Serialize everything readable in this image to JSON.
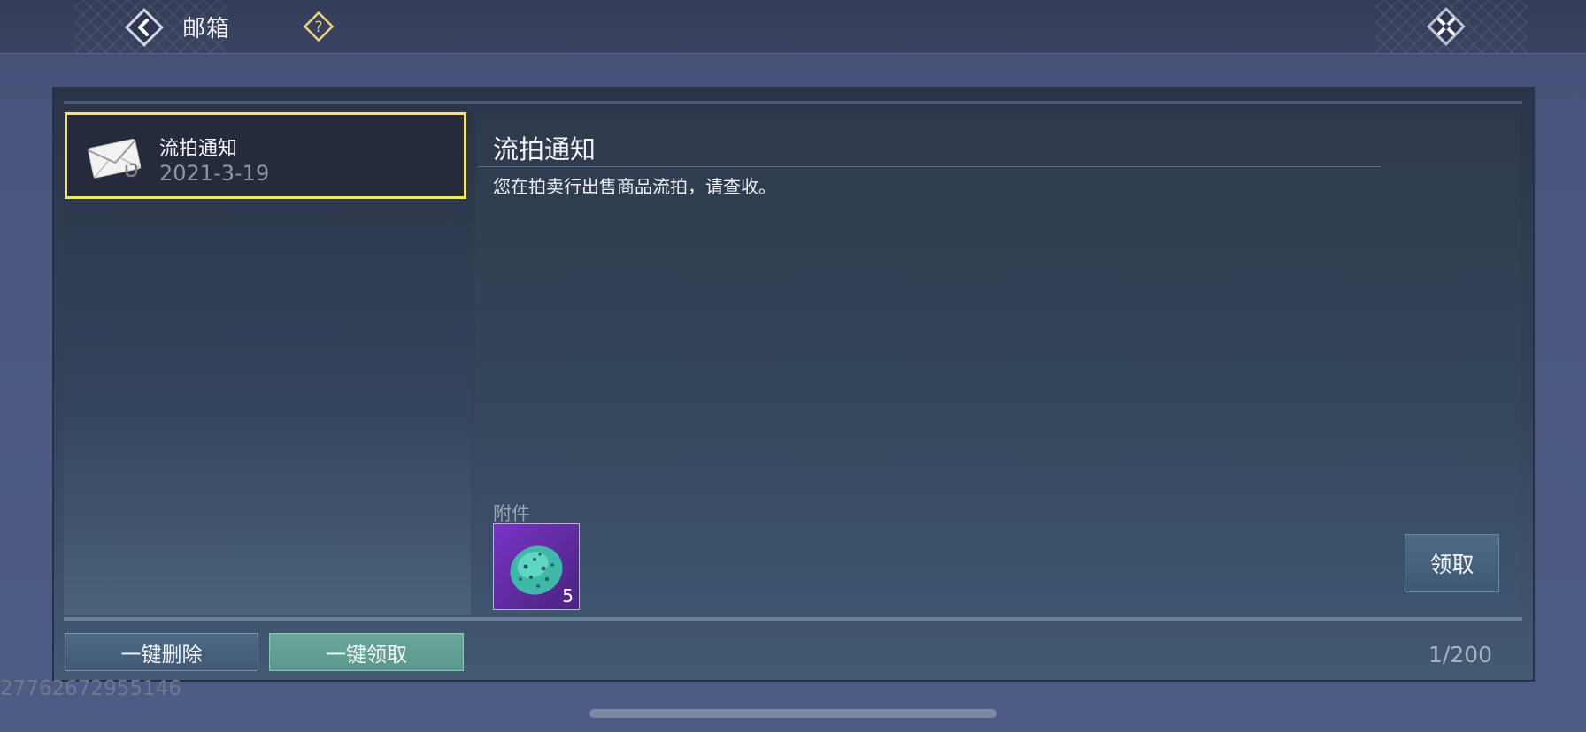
{
  "header": {
    "title": "邮箱",
    "back_icon": "back-arrow-icon",
    "help_icon": "question-diamond-icon",
    "close_icon": "close-x-icon"
  },
  "mail_list": {
    "items": [
      {
        "title": "流拍通知",
        "date": "2021-3-19",
        "icon": "mail-attachment-icon",
        "selected": true
      }
    ]
  },
  "mail_detail": {
    "title": "流拍通知",
    "body": "您在拍卖行出售商品流拍，请查收。",
    "attachment_label": "附件",
    "attachments": [
      {
        "item_icon": "gem-stone-icon",
        "count": "5"
      }
    ],
    "claim_label": "领取"
  },
  "footer": {
    "delete_all_label": "一键删除",
    "claim_all_label": "一键领取",
    "mail_count": "1/200"
  },
  "user_id": "27762672955146",
  "colors": {
    "selected_border": "#f2e36b",
    "claim_all_button": "#6aa89c",
    "attachment_rarity": "#7a33c8",
    "help_icon": "#e8d27a"
  }
}
